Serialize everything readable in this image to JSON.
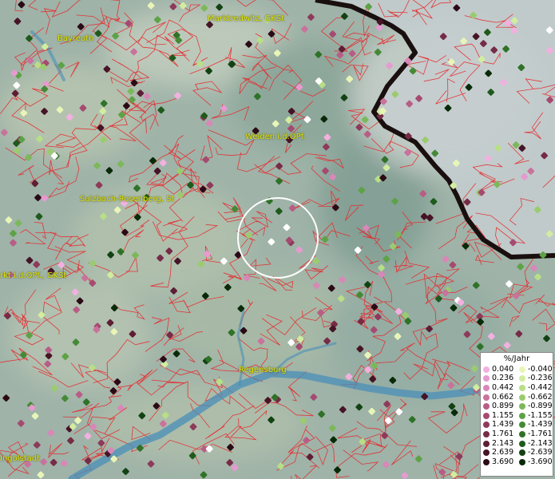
{
  "map": {
    "cities": [
      {
        "id": "bayreuth",
        "label": "Bayreuth"
      },
      {
        "id": "marktredwitz",
        "label": "Marktredwitz, GKSt"
      },
      {
        "id": "weiden",
        "label": "Weiden i.d.OPf."
      },
      {
        "id": "sulzbach",
        "label": "Sulzbach-Rosenberg, St"
      },
      {
        "id": "neumarkt",
        "label": "rkt i.d.OPf., GKSt"
      },
      {
        "id": "regensburg",
        "label": "Regensburg"
      },
      {
        "id": "ingolstadt",
        "label": "Ingolstadt"
      }
    ],
    "colors": {
      "boundary": "#e8282c",
      "river": "#4a8fb8",
      "border": "#1a0f0f",
      "focus_circle": "#ffffff"
    }
  },
  "legend": {
    "title": "%/Jahr",
    "positive": [
      {
        "label": "0.040",
        "color": "#f2b0e0"
      },
      {
        "label": "0.236",
        "color": "#e69ad0"
      },
      {
        "label": "0.442",
        "color": "#d887b8"
      },
      {
        "label": "0.662",
        "color": "#c9729c"
      },
      {
        "label": "0.899",
        "color": "#b85d86"
      },
      {
        "label": "1.155",
        "color": "#a54a70"
      },
      {
        "label": "1.439",
        "color": "#8e3a5a"
      },
      {
        "label": "1.761",
        "color": "#762b46"
      },
      {
        "label": "2.143",
        "color": "#5e1e35"
      },
      {
        "label": "2.639",
        "color": "#461426"
      },
      {
        "label": "3.690",
        "color": "#2b0a16"
      }
    ],
    "negative": [
      {
        "label": "-0.040",
        "color": "#e8f5b8"
      },
      {
        "label": "-0.236",
        "color": "#d2eca0"
      },
      {
        "label": "-0.442",
        "color": "#b8de88"
      },
      {
        "label": "-0.662",
        "color": "#9bcb70"
      },
      {
        "label": "-0.899",
        "color": "#7cb85a"
      },
      {
        "label": "-1.155",
        "color": "#5ea247"
      },
      {
        "label": "-1.439",
        "color": "#448a36"
      },
      {
        "label": "-1.761",
        "color": "#2f7228"
      },
      {
        "label": "-2.143",
        "color": "#1e5a1c"
      },
      {
        "label": "-2.639",
        "color": "#124212"
      },
      {
        "label": "-3.690",
        "color": "#082a08"
      }
    ]
  }
}
